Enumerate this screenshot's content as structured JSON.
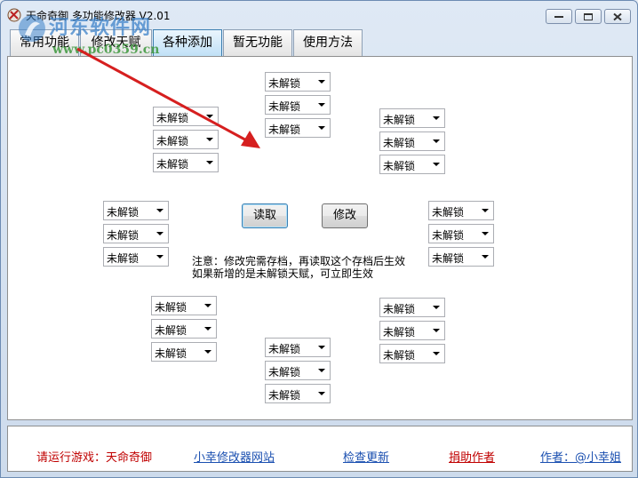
{
  "window": {
    "title": "天命奇御 多功能修改器 V2.01"
  },
  "watermark": {
    "line1": "河东软件网",
    "line2": "www.pc0359.cn"
  },
  "tabs": [
    {
      "label": "常用功能"
    },
    {
      "label": "修改天赋"
    },
    {
      "label": "各种添加"
    },
    {
      "label": "暂无功能"
    },
    {
      "label": "使用方法"
    }
  ],
  "dropdowns": {
    "top_center": [
      "未解锁",
      "未解锁",
      "未解锁"
    ],
    "upper_left": [
      "未解锁",
      "未解锁",
      "未解锁"
    ],
    "upper_right": [
      "未解锁",
      "未解锁",
      "未解锁"
    ],
    "mid_left": [
      "未解锁",
      "未解锁",
      "未解锁"
    ],
    "mid_right": [
      "未解锁",
      "未解锁",
      "未解锁"
    ],
    "lower_left": [
      "未解锁",
      "未解锁",
      "未解锁"
    ],
    "lower_right": [
      "未解锁",
      "未解锁",
      "未解锁"
    ],
    "bottom_center": [
      "未解锁",
      "未解锁",
      "未解锁"
    ]
  },
  "buttons": {
    "read": "读取",
    "modify": "修改"
  },
  "notice": {
    "line1": "注意：修改完需存档，再读取这个存档后生效",
    "line2": "如果新增的是未解锁天赋，可立即生效"
  },
  "status": {
    "run_game": "请运行游戏：天命奇御",
    "site_link": "小幸修改器网站",
    "update_link": "检查更新",
    "donate_link": "捐助作者",
    "author_link": "作者：@小幸姐"
  }
}
